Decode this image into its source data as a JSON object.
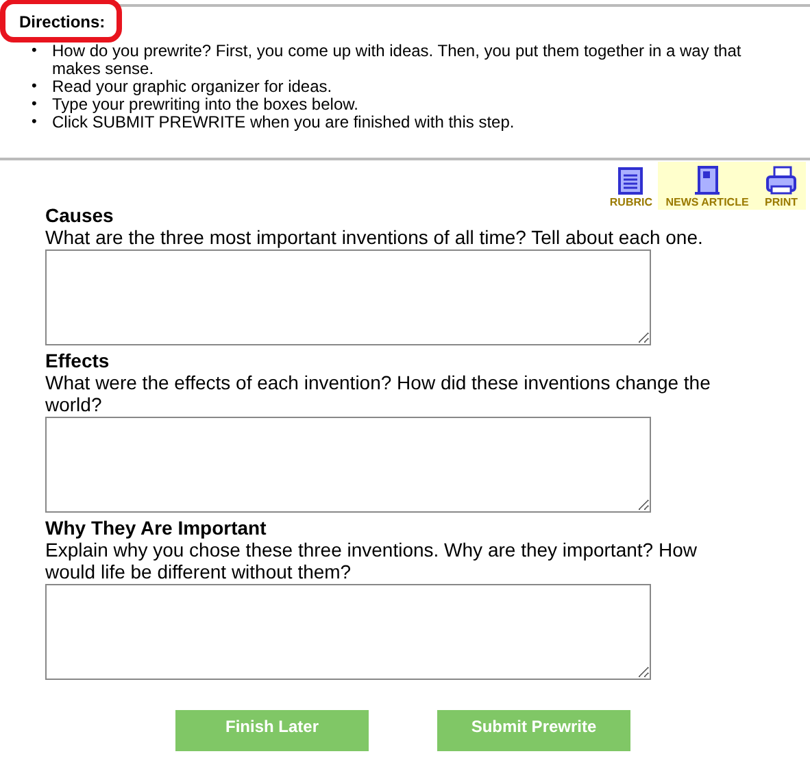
{
  "directions": {
    "title": "Directions:",
    "items": [
      {
        "bullet": "•",
        "text": "How do you prewrite? First, you come up with ideas. Then, you put them together in a way that makes sense."
      },
      {
        "bullet": "•",
        "text": "Read your graphic organizer for ideas."
      },
      {
        "bullet": "•",
        "text": "Type your prewriting into the boxes below."
      },
      {
        "bullet": "•",
        "text": "Click SUBMIT PREWRITE when you are finished with this step."
      }
    ]
  },
  "tools": [
    {
      "kind": "rubric",
      "label": "RUBRIC",
      "highlighted": false
    },
    {
      "kind": "article",
      "label": "NEWS ARTICLE",
      "highlighted": true
    },
    {
      "kind": "print",
      "label": "PRINT",
      "highlighted": true
    }
  ],
  "sections": [
    {
      "title": "Causes",
      "prompt": "What are the three most important inventions of all time? Tell about each one."
    },
    {
      "title": "Effects",
      "prompt": "What were the effects of each invention? How did these inventions change the world?"
    },
    {
      "title": "Why They Are Important",
      "prompt": "Explain why you chose these three inventions. Why are they important? How would life be different without them?"
    }
  ],
  "buttons": [
    "Finish Later",
    "Submit Prewrite"
  ]
}
